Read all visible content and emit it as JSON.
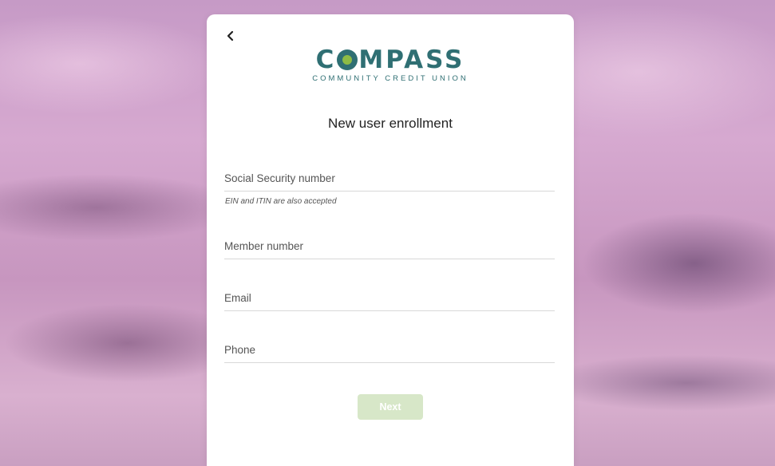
{
  "logo": {
    "word_left": "C",
    "word_right": "MPASS",
    "subtitle": "COMMUNITY CREDIT UNION",
    "colors": {
      "primary": "#2f6f73",
      "accent": "#8dbb45"
    }
  },
  "header": {
    "back_icon": "chevron-left-icon"
  },
  "form": {
    "title": "New user enrollment",
    "ssn": {
      "placeholder": "Social Security number",
      "value": "",
      "hint": "EIN and ITIN are also accepted"
    },
    "member_number": {
      "placeholder": "Member number",
      "value": ""
    },
    "email": {
      "placeholder": "Email",
      "value": ""
    },
    "phone": {
      "placeholder": "Phone",
      "value": ""
    },
    "next_label": "Next",
    "next_color": "#d7e7c8"
  }
}
